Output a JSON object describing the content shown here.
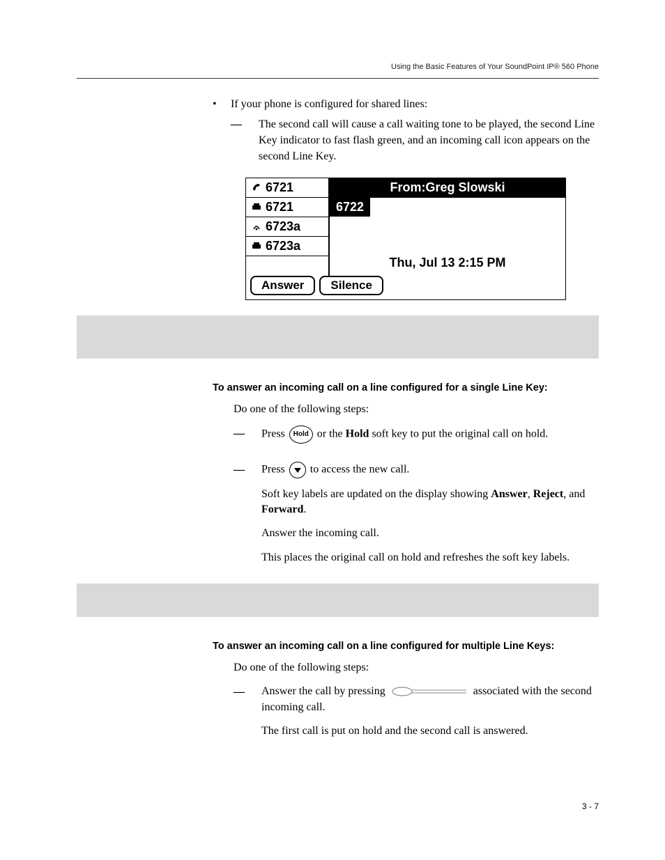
{
  "running_head": "Using the Basic Features of Your SoundPoint IP® 560 Phone",
  "bullet_intro": "If your phone is configured for shared lines:",
  "bullet_dash": "The second call will cause a call waiting tone to be played, the second Line Key indicator to fast flash green, and an incoming call icon appears on the second Line Key.",
  "lcd": {
    "lines": [
      "6721",
      "6721",
      "6723a",
      "6723a"
    ],
    "from_label": "From:Greg Slowski",
    "from_number": "6722",
    "datetime": "Thu, Jul 13  2:15 PM",
    "softkeys": [
      "Answer",
      "Silence"
    ]
  },
  "task1": {
    "heading": "To answer an incoming call on a line configured for a single Line Key:",
    "intro": "Do one of the following steps:",
    "hold_badge": "Hold",
    "step1_before": "Press ",
    "step1_after_badge": " or the ",
    "step1_bold": "Hold",
    "step1_tail": " soft key to put the original call on hold.",
    "step2_before": "Press  ",
    "step2_after": " to access the new call.",
    "para1_a": "Soft key labels are updated on the display showing ",
    "para1_b1": "Answer",
    "para1_s1": ", ",
    "para1_b2": "Reject",
    "para1_s2": ", and ",
    "para1_b3": "Forward",
    "para1_tail": ".",
    "para2": "Answer the incoming call.",
    "para3": "This places the original call on hold and refreshes the soft key labels."
  },
  "task2": {
    "heading": "To answer an incoming call on a line configured for multiple Line Keys:",
    "intro": "Do one of the following steps:",
    "step1_before": "Answer the call by pressing  ",
    "step1_after": " associated with the second incoming call.",
    "para1": "The first call is put on hold and the second call is answered."
  },
  "page_number": "3 - 7",
  "icons": {
    "handset": "handset-icon",
    "phone": "phone-icon",
    "ringing": "ringing-icon"
  }
}
